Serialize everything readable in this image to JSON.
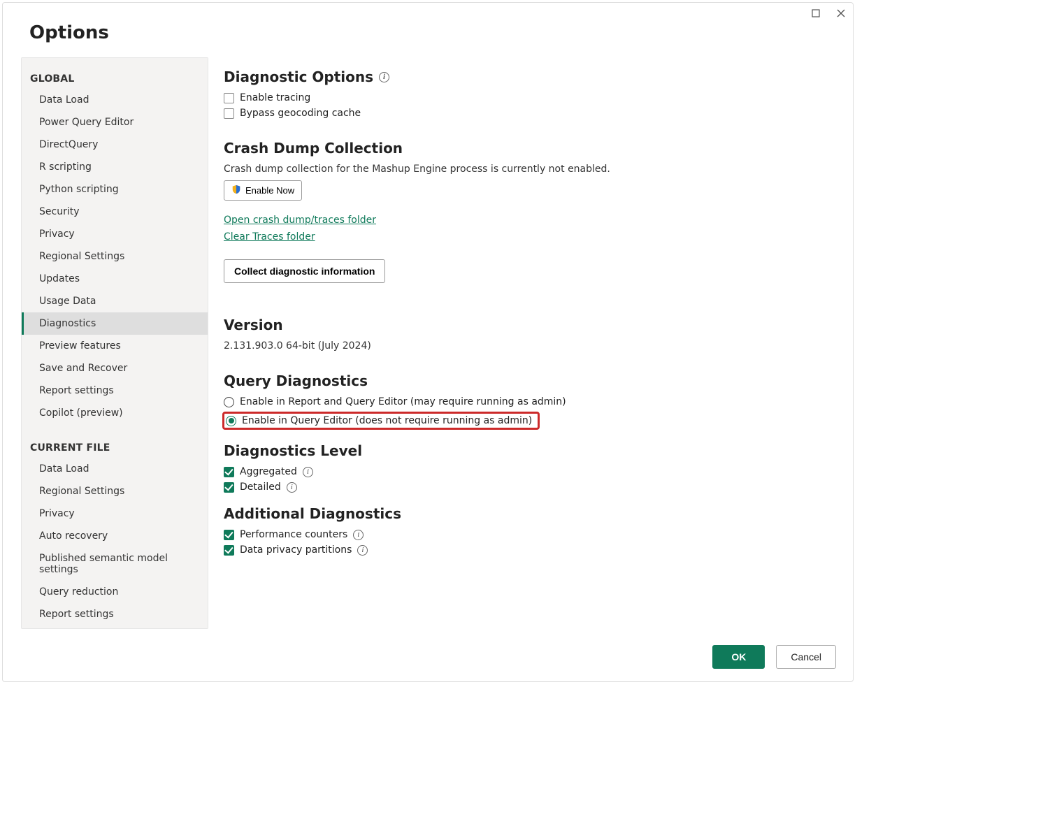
{
  "window": {
    "title": "Options"
  },
  "sidebar": {
    "global_heading": "GLOBAL",
    "global_items": [
      "Data Load",
      "Power Query Editor",
      "DirectQuery",
      "R scripting",
      "Python scripting",
      "Security",
      "Privacy",
      "Regional Settings",
      "Updates",
      "Usage Data",
      "Diagnostics",
      "Preview features",
      "Save and Recover",
      "Report settings",
      "Copilot (preview)"
    ],
    "global_selected_index": 10,
    "current_file_heading": "CURRENT FILE",
    "current_file_items": [
      "Data Load",
      "Regional Settings",
      "Privacy",
      "Auto recovery",
      "Published semantic model settings",
      "Query reduction",
      "Report settings"
    ]
  },
  "diagnostic_options": {
    "title": "Diagnostic Options",
    "enable_tracing": {
      "label": "Enable tracing",
      "checked": false
    },
    "bypass_geocoding": {
      "label": "Bypass geocoding cache",
      "checked": false
    }
  },
  "crash_dump": {
    "title": "Crash Dump Collection",
    "desc": "Crash dump collection for the Mashup Engine process is currently not enabled.",
    "enable_now": "Enable Now",
    "open_folder_link": "Open crash dump/traces folder",
    "clear_folder_link": "Clear Traces folder",
    "collect_button": "Collect diagnostic information"
  },
  "version": {
    "title": "Version",
    "value": "2.131.903.0 64-bit (July 2024)"
  },
  "query_diagnostics": {
    "title": "Query Diagnostics",
    "option_report_editor": "Enable in Report and Query Editor (may require running as admin)",
    "option_query_editor": "Enable in Query Editor (does not require running as admin)",
    "selected": "query_editor"
  },
  "diagnostics_level": {
    "title": "Diagnostics Level",
    "aggregated": {
      "label": "Aggregated",
      "checked": true
    },
    "detailed": {
      "label": "Detailed",
      "checked": true
    }
  },
  "additional_diagnostics": {
    "title": "Additional Diagnostics",
    "perf_counters": {
      "label": "Performance counters",
      "checked": true
    },
    "data_privacy": {
      "label": "Data privacy partitions",
      "checked": true
    }
  },
  "buttons": {
    "ok": "OK",
    "cancel": "Cancel"
  }
}
